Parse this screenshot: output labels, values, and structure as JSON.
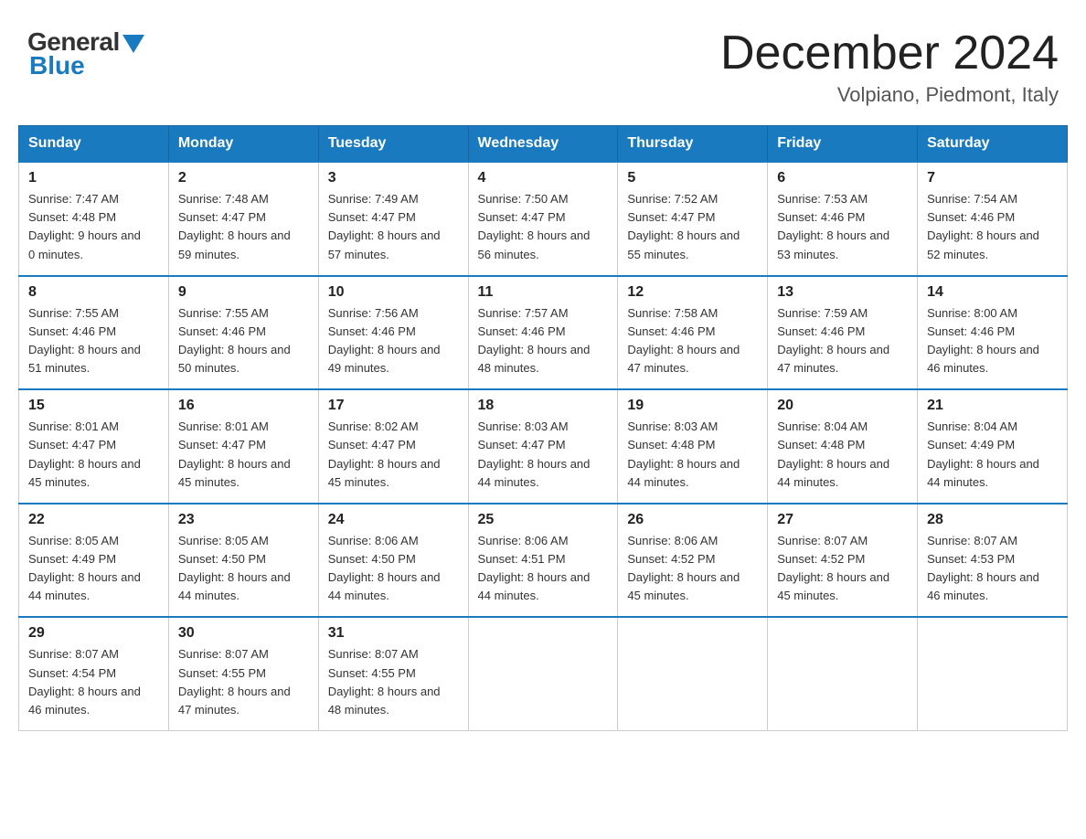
{
  "logo": {
    "general": "General",
    "blue": "Blue"
  },
  "title": "December 2024",
  "subtitle": "Volpiano, Piedmont, Italy",
  "days_of_week": [
    "Sunday",
    "Monday",
    "Tuesday",
    "Wednesday",
    "Thursday",
    "Friday",
    "Saturday"
  ],
  "weeks": [
    [
      {
        "day": "1",
        "sunrise": "Sunrise: 7:47 AM",
        "sunset": "Sunset: 4:48 PM",
        "daylight": "Daylight: 9 hours and 0 minutes."
      },
      {
        "day": "2",
        "sunrise": "Sunrise: 7:48 AM",
        "sunset": "Sunset: 4:47 PM",
        "daylight": "Daylight: 8 hours and 59 minutes."
      },
      {
        "day": "3",
        "sunrise": "Sunrise: 7:49 AM",
        "sunset": "Sunset: 4:47 PM",
        "daylight": "Daylight: 8 hours and 57 minutes."
      },
      {
        "day": "4",
        "sunrise": "Sunrise: 7:50 AM",
        "sunset": "Sunset: 4:47 PM",
        "daylight": "Daylight: 8 hours and 56 minutes."
      },
      {
        "day": "5",
        "sunrise": "Sunrise: 7:52 AM",
        "sunset": "Sunset: 4:47 PM",
        "daylight": "Daylight: 8 hours and 55 minutes."
      },
      {
        "day": "6",
        "sunrise": "Sunrise: 7:53 AM",
        "sunset": "Sunset: 4:46 PM",
        "daylight": "Daylight: 8 hours and 53 minutes."
      },
      {
        "day": "7",
        "sunrise": "Sunrise: 7:54 AM",
        "sunset": "Sunset: 4:46 PM",
        "daylight": "Daylight: 8 hours and 52 minutes."
      }
    ],
    [
      {
        "day": "8",
        "sunrise": "Sunrise: 7:55 AM",
        "sunset": "Sunset: 4:46 PM",
        "daylight": "Daylight: 8 hours and 51 minutes."
      },
      {
        "day": "9",
        "sunrise": "Sunrise: 7:55 AM",
        "sunset": "Sunset: 4:46 PM",
        "daylight": "Daylight: 8 hours and 50 minutes."
      },
      {
        "day": "10",
        "sunrise": "Sunrise: 7:56 AM",
        "sunset": "Sunset: 4:46 PM",
        "daylight": "Daylight: 8 hours and 49 minutes."
      },
      {
        "day": "11",
        "sunrise": "Sunrise: 7:57 AM",
        "sunset": "Sunset: 4:46 PM",
        "daylight": "Daylight: 8 hours and 48 minutes."
      },
      {
        "day": "12",
        "sunrise": "Sunrise: 7:58 AM",
        "sunset": "Sunset: 4:46 PM",
        "daylight": "Daylight: 8 hours and 47 minutes."
      },
      {
        "day": "13",
        "sunrise": "Sunrise: 7:59 AM",
        "sunset": "Sunset: 4:46 PM",
        "daylight": "Daylight: 8 hours and 47 minutes."
      },
      {
        "day": "14",
        "sunrise": "Sunrise: 8:00 AM",
        "sunset": "Sunset: 4:46 PM",
        "daylight": "Daylight: 8 hours and 46 minutes."
      }
    ],
    [
      {
        "day": "15",
        "sunrise": "Sunrise: 8:01 AM",
        "sunset": "Sunset: 4:47 PM",
        "daylight": "Daylight: 8 hours and 45 minutes."
      },
      {
        "day": "16",
        "sunrise": "Sunrise: 8:01 AM",
        "sunset": "Sunset: 4:47 PM",
        "daylight": "Daylight: 8 hours and 45 minutes."
      },
      {
        "day": "17",
        "sunrise": "Sunrise: 8:02 AM",
        "sunset": "Sunset: 4:47 PM",
        "daylight": "Daylight: 8 hours and 45 minutes."
      },
      {
        "day": "18",
        "sunrise": "Sunrise: 8:03 AM",
        "sunset": "Sunset: 4:47 PM",
        "daylight": "Daylight: 8 hours and 44 minutes."
      },
      {
        "day": "19",
        "sunrise": "Sunrise: 8:03 AM",
        "sunset": "Sunset: 4:48 PM",
        "daylight": "Daylight: 8 hours and 44 minutes."
      },
      {
        "day": "20",
        "sunrise": "Sunrise: 8:04 AM",
        "sunset": "Sunset: 4:48 PM",
        "daylight": "Daylight: 8 hours and 44 minutes."
      },
      {
        "day": "21",
        "sunrise": "Sunrise: 8:04 AM",
        "sunset": "Sunset: 4:49 PM",
        "daylight": "Daylight: 8 hours and 44 minutes."
      }
    ],
    [
      {
        "day": "22",
        "sunrise": "Sunrise: 8:05 AM",
        "sunset": "Sunset: 4:49 PM",
        "daylight": "Daylight: 8 hours and 44 minutes."
      },
      {
        "day": "23",
        "sunrise": "Sunrise: 8:05 AM",
        "sunset": "Sunset: 4:50 PM",
        "daylight": "Daylight: 8 hours and 44 minutes."
      },
      {
        "day": "24",
        "sunrise": "Sunrise: 8:06 AM",
        "sunset": "Sunset: 4:50 PM",
        "daylight": "Daylight: 8 hours and 44 minutes."
      },
      {
        "day": "25",
        "sunrise": "Sunrise: 8:06 AM",
        "sunset": "Sunset: 4:51 PM",
        "daylight": "Daylight: 8 hours and 44 minutes."
      },
      {
        "day": "26",
        "sunrise": "Sunrise: 8:06 AM",
        "sunset": "Sunset: 4:52 PM",
        "daylight": "Daylight: 8 hours and 45 minutes."
      },
      {
        "day": "27",
        "sunrise": "Sunrise: 8:07 AM",
        "sunset": "Sunset: 4:52 PM",
        "daylight": "Daylight: 8 hours and 45 minutes."
      },
      {
        "day": "28",
        "sunrise": "Sunrise: 8:07 AM",
        "sunset": "Sunset: 4:53 PM",
        "daylight": "Daylight: 8 hours and 46 minutes."
      }
    ],
    [
      {
        "day": "29",
        "sunrise": "Sunrise: 8:07 AM",
        "sunset": "Sunset: 4:54 PM",
        "daylight": "Daylight: 8 hours and 46 minutes."
      },
      {
        "day": "30",
        "sunrise": "Sunrise: 8:07 AM",
        "sunset": "Sunset: 4:55 PM",
        "daylight": "Daylight: 8 hours and 47 minutes."
      },
      {
        "day": "31",
        "sunrise": "Sunrise: 8:07 AM",
        "sunset": "Sunset: 4:55 PM",
        "daylight": "Daylight: 8 hours and 48 minutes."
      },
      null,
      null,
      null,
      null
    ]
  ]
}
